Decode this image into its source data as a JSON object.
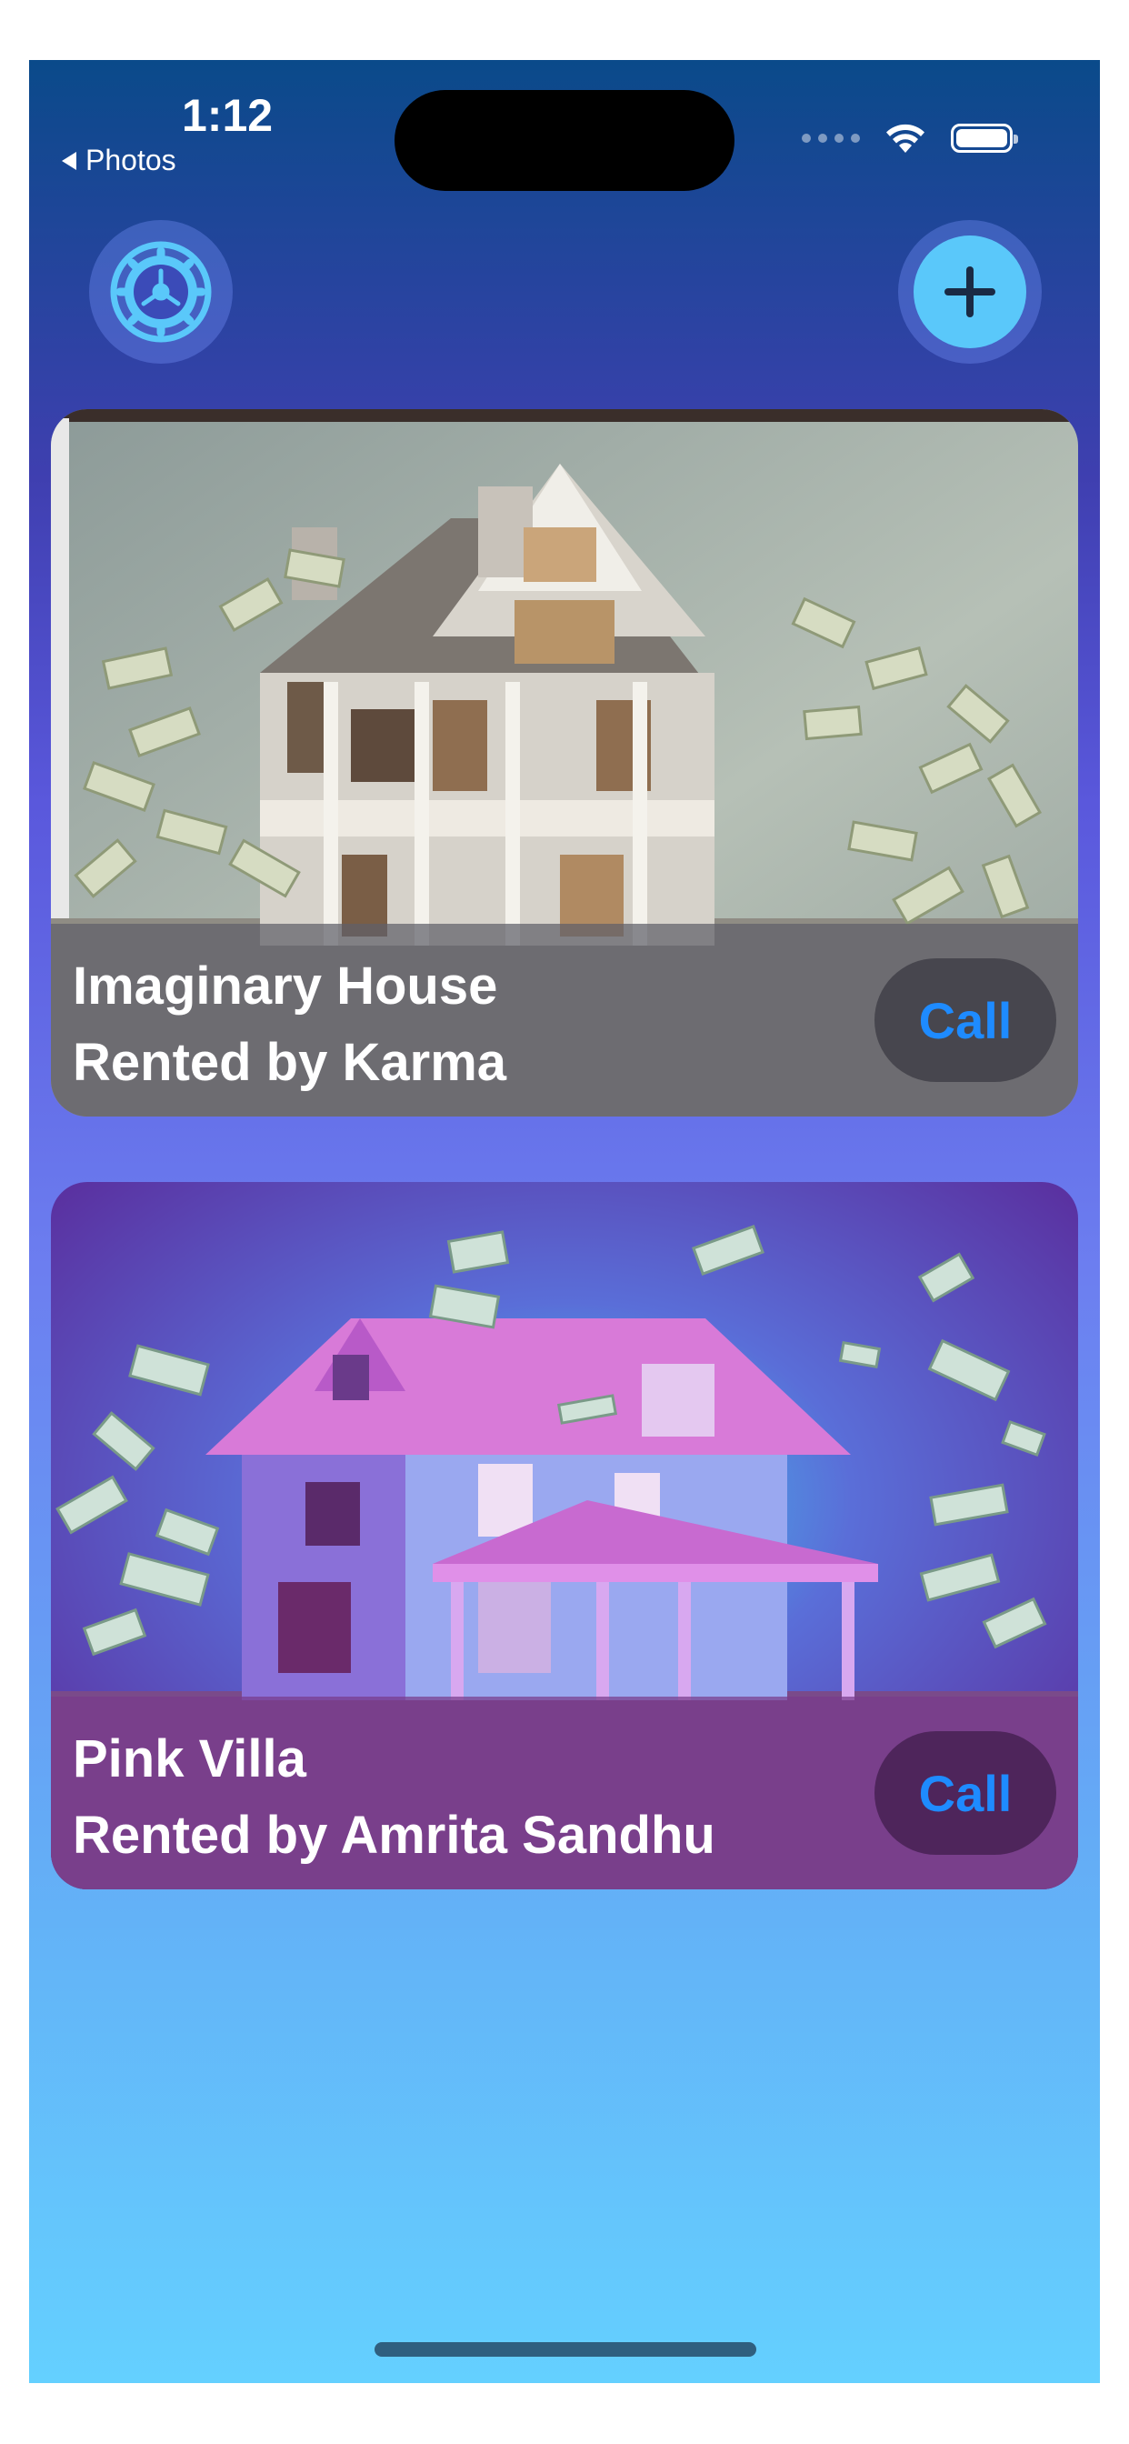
{
  "status_bar": {
    "time": "1:12",
    "back_label": "Photos"
  },
  "toolbar": {
    "settings_icon": "gear-icon",
    "add_icon": "plus-icon"
  },
  "colors": {
    "accent": "#1e8bff",
    "add_button": "#5ac8fa"
  },
  "properties": [
    {
      "title": "Imaginary House",
      "subtitle": "Rented by Karma",
      "call_label": "Call"
    },
    {
      "title": "Pink Villa",
      "subtitle": "Rented by Amrita Sandhu",
      "call_label": "Call"
    }
  ]
}
